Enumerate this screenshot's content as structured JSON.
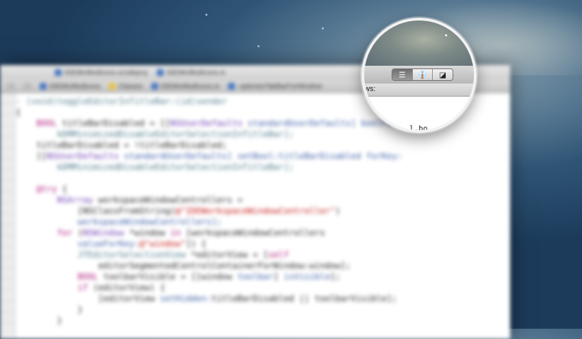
{
  "window": {
    "tabs": [
      "IDEMinifiedIcons.xcodeproj",
      "IDEMinifiedIcons.m"
    ],
    "breadcrumbs": [
      "IDEMinifiedIcons",
      "Classes",
      "IDEMinifiedIcons.m",
      "-optimizeTabBarForWindow:"
    ]
  },
  "lens": {
    "segmented_control": [
      {
        "icon": "standard-editor-icon",
        "glyph": "☰",
        "selected": true
      },
      {
        "icon": "assistant-editor-icon",
        "glyph": "👔",
        "selected": false
      },
      {
        "icon": "version-editor-icon",
        "glyph": "◪",
        "selected": false
      }
    ],
    "path_text": "ws:",
    "code_fragment": "l.bo"
  },
  "code_lines": [
    [
      {
        "t": "- (void)toggleEditorInTitleBar:(id)sender",
        "c": "def"
      }
    ],
    [
      {
        "t": "{"
      }
    ],
    [
      {
        "t": "    "
      },
      {
        "t": "BOOL",
        "c": "kw"
      },
      {
        "t": " titleBarDisabled = [["
      },
      {
        "t": "NSUserDefaults",
        "c": "cls"
      },
      {
        "t": " standardUserDefaults] boolForKey:",
        "c": "mth"
      }
    ],
    [
      {
        "t": "        kDMMinimizedDisableEditorSelectionInTitleBar];",
        "c": "def"
      }
    ],
    [
      {
        "t": "    titleBarDisabled = !titleBarDisabled;"
      }
    ],
    [
      {
        "t": "    [["
      },
      {
        "t": "NSUserDefaults",
        "c": "cls"
      },
      {
        "t": " standardUserDefaults] setBool:titleBarDisabled forKey:",
        "c": "mth"
      }
    ],
    [
      {
        "t": "        kDMMinimizedDisableEditorSelectionInTitleBar];",
        "c": "def"
      }
    ],
    [
      {
        "t": ""
      }
    ],
    [
      {
        "t": "    "
      },
      {
        "t": "@try",
        "c": "kw"
      },
      {
        "t": " {"
      }
    ],
    [
      {
        "t": "        "
      },
      {
        "t": "NSArray",
        "c": "cls"
      },
      {
        "t": " workspaceWindowControllers ="
      }
    ],
    [
      {
        "t": "            [NSClassFromString("
      },
      {
        "t": "@\"IDEWorkspaceWindowController\"",
        "c": "str"
      },
      {
        "t": ")"
      }
    ],
    [
      {
        "t": "            workspaceWindowControllers];",
        "c": "mth"
      }
    ],
    [
      {
        "t": "        "
      },
      {
        "t": "for",
        "c": "kw"
      },
      {
        "t": " ("
      },
      {
        "t": "NSWindow",
        "c": "cls"
      },
      {
        "t": " *window "
      },
      {
        "t": "in",
        "c": "kw"
      },
      {
        "t": " [workspaceWindowControllers"
      }
    ],
    [
      {
        "t": "            valueForKey:",
        "c": "mth"
      },
      {
        "t": "@\"window\"",
        "c": "str"
      },
      {
        "t": "]) {"
      }
    ],
    [
      {
        "t": "            "
      },
      {
        "t": "JTEditorSelectionView",
        "c": "def"
      },
      {
        "t": " *editorView = ["
      },
      {
        "t": "self",
        "c": "kw"
      }
    ],
    [
      {
        "t": "                editorSegmentedControlContainerForWindow:window];"
      }
    ],
    [
      {
        "t": "            "
      },
      {
        "t": "BOOL",
        "c": "kw"
      },
      {
        "t": " toolbarVisible = [[window "
      },
      {
        "t": "toolbar",
        "c": "mth"
      },
      {
        "t": "] "
      },
      {
        "t": "isVisible",
        "c": "mth"
      },
      {
        "t": "];"
      }
    ],
    [
      {
        "t": "            "
      },
      {
        "t": "if",
        "c": "kw"
      },
      {
        "t": " (editorView) {"
      }
    ],
    [
      {
        "t": "                [editorView "
      },
      {
        "t": "setHidden:",
        "c": "mth"
      },
      {
        "t": "titleBarDisabled || toolbarVisible];"
      }
    ],
    [
      {
        "t": "            }"
      }
    ],
    [
      {
        "t": "        }"
      }
    ]
  ]
}
